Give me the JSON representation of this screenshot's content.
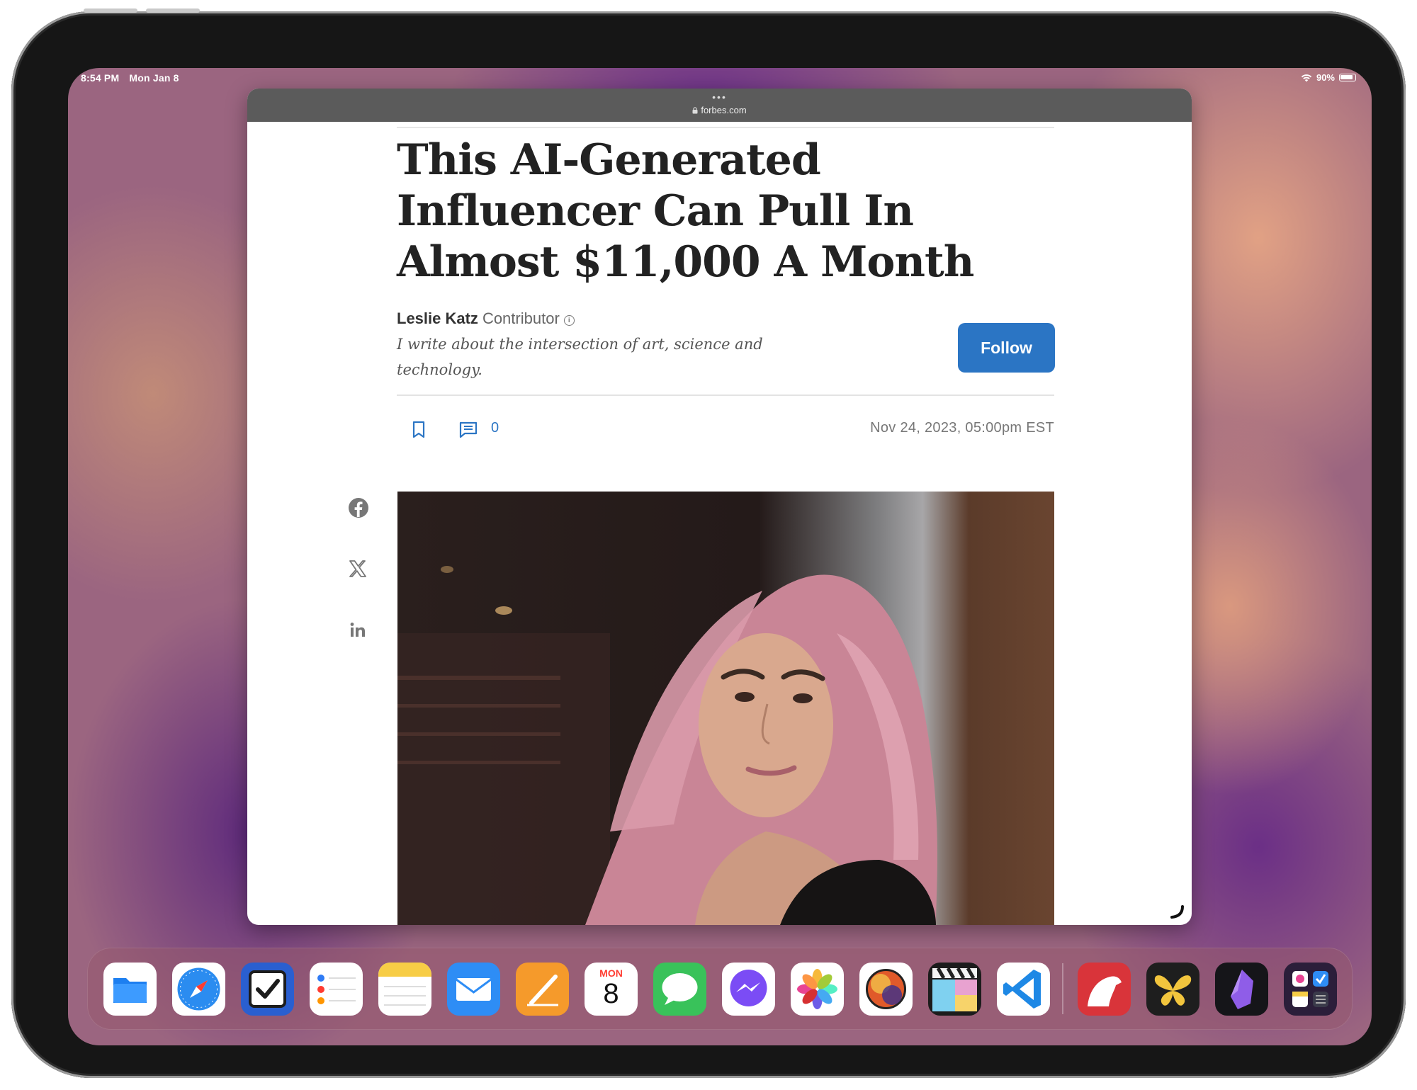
{
  "status_bar": {
    "time": "8:54 PM",
    "date": "Mon Jan 8",
    "battery": "90%"
  },
  "browser": {
    "url": "forbes.com",
    "dots": "•••"
  },
  "article": {
    "headline": "This AI-Generated Influencer Can Pull In Almost $11,000 A Month",
    "author": "Leslie Katz",
    "role": "Contributor",
    "bio": "I write about the intersection of art, science and technology.",
    "follow_label": "Follow",
    "comment_count": "0",
    "date": "Nov 24, 2023, 05:00pm EST"
  },
  "dock": {
    "calendar_day": "MON",
    "calendar_date": "8",
    "apps": [
      "Files",
      "Safari",
      "OmniFocus",
      "Reminders",
      "Notes",
      "Mail",
      "Pages",
      "Calendar",
      "Messages",
      "Messenger",
      "Photos",
      "Color Picker",
      "Final Cut Pro",
      "Visual Studio Code",
      "Bear",
      "Tes",
      "Obsidian",
      "App Library"
    ]
  },
  "colors": {
    "accent": "#2b75c4",
    "headline": "#222222"
  }
}
